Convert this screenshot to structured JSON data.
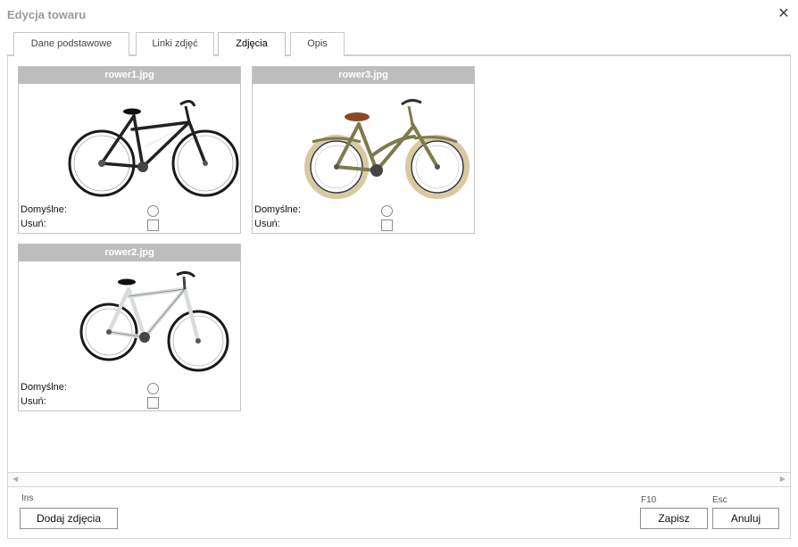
{
  "window": {
    "title": "Edycja towaru",
    "close_symbol": "✕"
  },
  "tabs": [
    {
      "label": "Dane podstawowe",
      "active": false
    },
    {
      "label": "Linki zdjęć",
      "active": false
    },
    {
      "label": "Zdjęcia",
      "active": true
    },
    {
      "label": "Opis",
      "active": false
    }
  ],
  "photos": [
    {
      "filename": "rower1.jpg",
      "default_label": "Domyślne:",
      "delete_label": "Usuń:",
      "default_selected": false,
      "delete_checked": false,
      "image": "black-white-city-bike"
    },
    {
      "filename": "rower3.jpg",
      "default_label": "Domyślne:",
      "delete_label": "Usuń:",
      "default_selected": false,
      "delete_checked": false,
      "image": "olive-retro-bike-cream-tires"
    },
    {
      "filename": "rower2.jpg",
      "default_label": "Domyślne:",
      "delete_label": "Usuń:",
      "default_selected": false,
      "delete_checked": false,
      "image": "white-cross-bike"
    }
  ],
  "footer": {
    "add_shortcut": "Ins",
    "add_label": "Dodaj zdjęcia",
    "save_shortcut": "F10",
    "save_label": "Zapisz",
    "cancel_shortcut": "Esc",
    "cancel_label": "Anuluj"
  },
  "colors": {
    "card_header": "#bdbdbd",
    "title_text": "#9a9a9a"
  }
}
